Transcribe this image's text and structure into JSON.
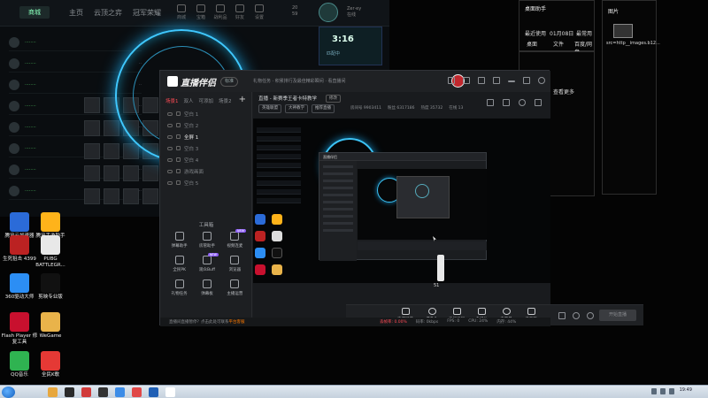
{
  "game": {
    "logo": "商城",
    "nav": [
      "主页",
      "云顶之弈",
      "冠军荣耀"
    ],
    "top_icons": [
      "商城",
      "宝箱",
      "战利品",
      "好友",
      "设置"
    ],
    "stats": [
      "20",
      "59"
    ],
    "user": [
      "Zer·ey",
      "在线"
    ],
    "timer": "3:16",
    "timer_sub": "匹配中"
  },
  "desktop_icons": [
    {
      "label": "腾讯云加速器",
      "color": "#2b6bd8"
    },
    {
      "label": "腾讯手游助手",
      "color": "#ffb31a"
    },
    {
      "label": "生死狙击 4399",
      "color": "#b22"
    },
    {
      "label": "PUBG BATTLEGR...",
      "color": "#e8e8e8"
    },
    {
      "label": "360驱动大师",
      "color": "#2c8ef4"
    },
    {
      "label": "剪映专业版",
      "color": "#111"
    },
    {
      "label": "Flash Player 修复工具",
      "color": "#c8102e"
    },
    {
      "label": "WeGame",
      "color": "#e9b34a"
    },
    {
      "label": "QQ音乐",
      "color": "#2fb351"
    },
    {
      "label": "全民K歌",
      "color": "#e53935"
    }
  ],
  "side_panels": {
    "desktop_panel": {
      "title": "桌面助手",
      "labels": [
        "最近使用",
        "01月08日",
        "最常用",
        "桌面",
        "文件",
        "百度/网盘"
      ],
      "more": "查看更多"
    },
    "image_panel": {
      "title": "图片",
      "file": "src=http__images.b12..."
    }
  },
  "app": {
    "logo": "直播伴侣",
    "badge": "标准",
    "ticker": "礼物任务 · 积累排行及最佳精彩瞬间 · 看直播间",
    "scene_tabs": [
      "场景1",
      "双人",
      "可添加",
      "场景2"
    ],
    "scenes": [
      {
        "label": "空白 1",
        "active": false
      },
      {
        "label": "空白 2",
        "active": false
      },
      {
        "label": "全屏 1",
        "active": true
      },
      {
        "label": "空白 3",
        "active": false
      },
      {
        "label": "空白 4",
        "active": false
      },
      {
        "label": "游戏画面",
        "active": false
      },
      {
        "label": "空白 5",
        "active": false
      }
    ],
    "tools_title": "工具箱",
    "tools": [
      {
        "label": "弹幕助手",
        "badge": ""
      },
      {
        "label": "房管助手",
        "badge": ""
      },
      {
        "label": "视频连麦",
        "badge": "NEW"
      },
      {
        "label": "全民PK",
        "badge": ""
      },
      {
        "label": "观众Buff",
        "badge": "NEW"
      },
      {
        "label": "浏览器",
        "badge": ""
      },
      {
        "label": "礼物任务",
        "badge": ""
      },
      {
        "label": "弹幕板",
        "badge": ""
      },
      {
        "label": "主播运营",
        "badge": ""
      }
    ],
    "room_title": "直播 - 新赛季王者卡特教学",
    "room_edit": "修改",
    "room_chips": [
      "英雄联盟",
      "大神教学",
      "推荐直播"
    ],
    "room_stats": [
      "房间号 9903411",
      "粉丝 6317186",
      "热度 35732",
      "在线 13"
    ],
    "bottom_items": [
      "直播屏幕",
      "摄像头",
      "手机投屏",
      "多媒体",
      "麦克风",
      "扬声器"
    ],
    "volume_value": "51",
    "start_button": "开始直播",
    "status_warning_prefix": "直播间直播暂停？点击此处可联系",
    "status_warning_link": "平台客服",
    "status_stats": [
      "码率: 0kbps",
      "FPS: 0",
      "CPU: 24%",
      "内存: 44%"
    ],
    "status_stats_highlight": "丢帧率: 0.00%"
  },
  "taskbar": {
    "clock": "19:49",
    "apps": [
      "#e7a73e",
      "#2a2a2a",
      "#d13b3b",
      "#333",
      "#3c8ce7",
      "#e04848",
      "#1f5fb5",
      "#ffffff"
    ]
  }
}
